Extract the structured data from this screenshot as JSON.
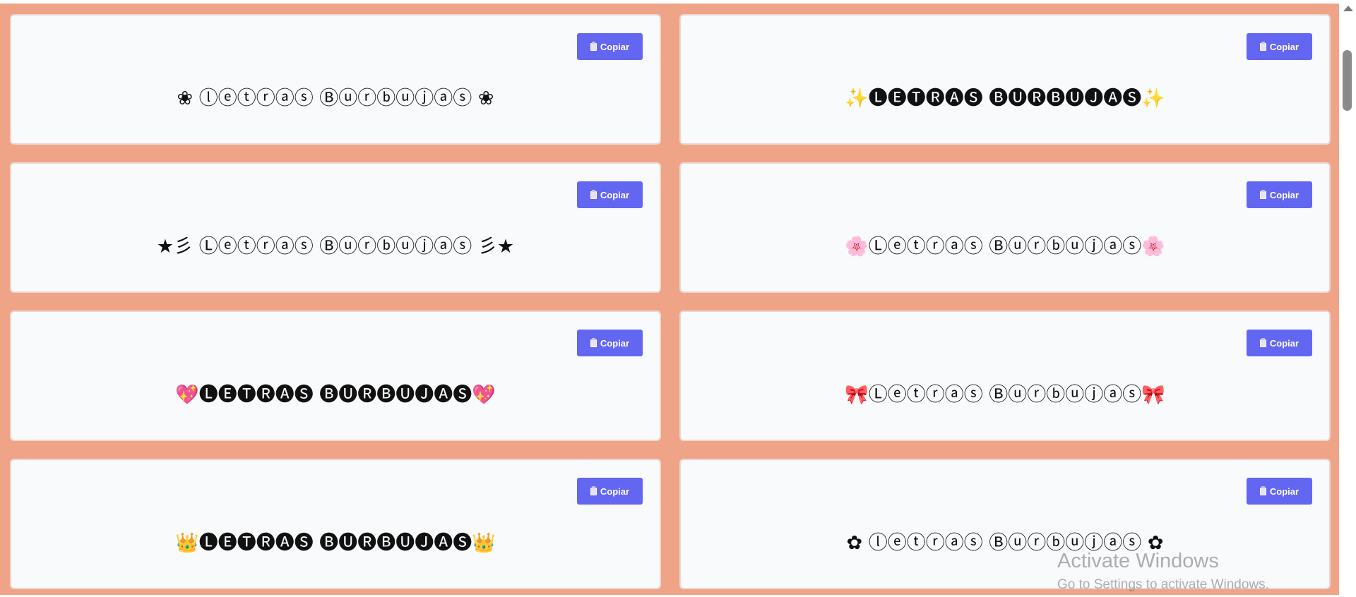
{
  "copy_icon": "clipboard-icon",
  "colors": {
    "background": "#f0a487",
    "card": "#f8fafc",
    "button": "#6366f1",
    "button_text": "#ffffff"
  },
  "cards": [
    {
      "text": "❀ ⓛⓔⓣⓡⓐⓢ Ⓑⓤⓡⓑⓤⓙⓐⓢ ❀",
      "button_label": "Copiar"
    },
    {
      "text": "✨🅛🅔🅣🅡🅐🅢 🅑🅤🅡🅑🅤🅙🅐🅢✨",
      "button_label": "Copiar"
    },
    {
      "text": "★彡 Ⓛⓔⓣⓡⓐⓢ Ⓑⓤⓡⓑⓤⓙⓐⓢ 彡★",
      "button_label": "Copiar"
    },
    {
      "text": "🌸Ⓛⓔⓣⓡⓐⓢ Ⓑⓤⓡⓑⓤⓙⓐⓢ🌸",
      "button_label": "Copiar"
    },
    {
      "text": "💖🅛🅔🅣🅡🅐🅢 🅑🅤🅡🅑🅤🅙🅐🅢💖",
      "button_label": "Copiar"
    },
    {
      "text": "🎀Ⓛⓔⓣⓡⓐⓢ Ⓑⓤⓡⓑⓤⓙⓐⓢ🎀",
      "button_label": "Copiar"
    },
    {
      "text": "👑🅛🅔🅣🅡🅐🅢 🅑🅤🅡🅑🅤🅙🅐🅢👑",
      "button_label": "Copiar"
    },
    {
      "text": "✿ ⓛⓔⓣⓡⓐⓢ Ⓑⓤⓡⓑⓤⓙⓐⓢ ✿",
      "button_label": "Copiar"
    }
  ],
  "watermark": {
    "title": "Activate Windows",
    "subtitle": "Go to Settings to activate Windows."
  }
}
